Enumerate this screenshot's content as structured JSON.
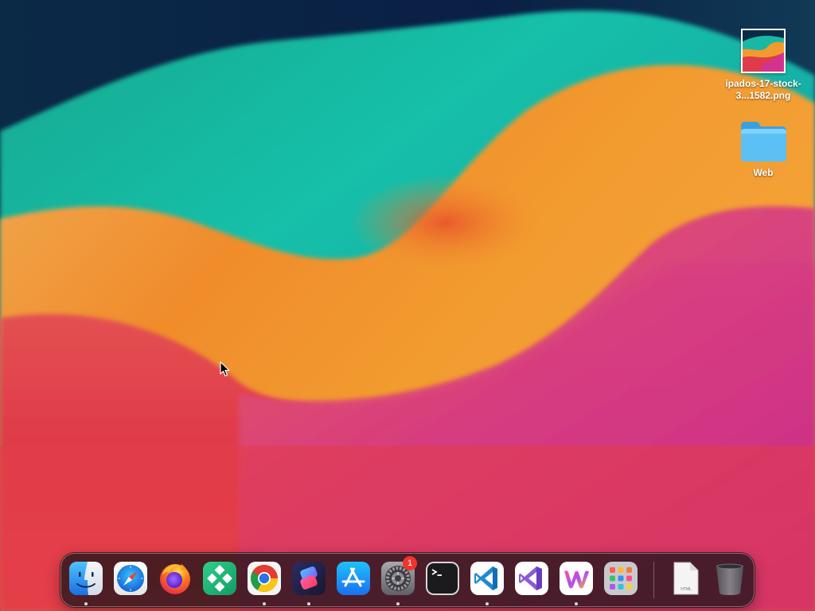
{
  "desktop": {
    "items": [
      {
        "label": "ipados-17-stock-3...1582.png",
        "icon": "image-thumbnail-icon"
      },
      {
        "label": "Web",
        "icon": "folder-icon"
      }
    ]
  },
  "dock": {
    "apps": [
      {
        "name": "Finder",
        "icon": "finder-icon",
        "running": true
      },
      {
        "name": "Safari",
        "icon": "safari-icon",
        "running": false
      },
      {
        "name": "Firefox",
        "icon": "firefox-icon",
        "running": false
      },
      {
        "name": "Navigator",
        "icon": "diamond-grid-icon",
        "running": false
      },
      {
        "name": "Google Chrome",
        "icon": "chrome-icon",
        "running": true
      },
      {
        "name": "Shortcuts",
        "icon": "shortcuts-icon",
        "running": true
      },
      {
        "name": "App Store",
        "icon": "app-store-icon",
        "running": false
      },
      {
        "name": "System Settings",
        "icon": "settings-gear-icon",
        "running": true,
        "badge": "1"
      },
      {
        "name": "Terminal",
        "icon": "terminal-icon",
        "running": false
      },
      {
        "name": "Visual Studio Code",
        "icon": "vscode-icon",
        "running": true
      },
      {
        "name": "Visual Studio",
        "icon": "visual-studio-icon",
        "running": false
      },
      {
        "name": "Webflow",
        "icon": "w-logo-icon",
        "running": true
      },
      {
        "name": "Launchpad",
        "icon": "launchpad-grid-icon",
        "running": false
      }
    ],
    "documents": [
      {
        "name": "HTML document",
        "icon": "html-file-icon",
        "file_label": "HTML"
      },
      {
        "name": "Trash",
        "icon": "trash-icon"
      }
    ]
  },
  "colors": {
    "navy": "#0b2244",
    "teal": "#13b8a6",
    "orange": "#f29a2e",
    "magenta": "#d3338f",
    "red": "#e03b4a",
    "badge_red": "#f0352e"
  }
}
